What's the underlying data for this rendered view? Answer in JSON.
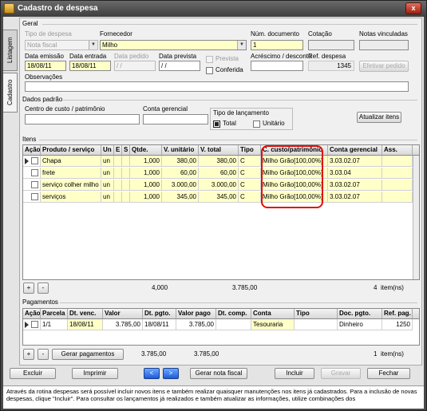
{
  "window": {
    "title": "Cadastro de despesa",
    "close": "x"
  },
  "tabs": [
    "Listagem",
    "Cadastro"
  ],
  "geral": {
    "section": "Geral",
    "tipo_label": "Tipo de despesa",
    "tipo_value": "Nota fiscal",
    "fornecedor_label": "Fornecedor",
    "fornecedor_value": "Milho",
    "num_doc_label": "Núm. documento",
    "num_doc_value": "1",
    "cotacao_label": "Cotação",
    "cotacao_value": "",
    "notas_label": "Notas vinculadas",
    "notas_value": "",
    "emissao_label": "Data emissão",
    "emissao_value": "18/08/11",
    "entrada_label": "Data entrada",
    "entrada_value": "18/08/11",
    "pedido_label": "Data pedido",
    "pedido_value": " / /",
    "prevista_label": "Data prevista",
    "prevista_value": " / /",
    "prevista_chk": "Prevista",
    "conferida_chk": "Conferida",
    "acrescimo_label": "Acréscimo / desconto",
    "acrescimo_value": "",
    "ref_label": "Ref. despesa",
    "ref_value": "1345",
    "efetivar_btn": "Efetivar pedido",
    "obs_label": "Observações",
    "obs_value": ""
  },
  "padrao": {
    "section": "Dados padrão",
    "centro_label": "Centro de custo / patrimônio",
    "centro_value": "",
    "conta_label": "Conta gerencial",
    "conta_value": "",
    "tipo_lanc_label": "Tipo de lançamento",
    "total_opt": "Total",
    "unitario_opt": "Unitário",
    "atualizar_btn": "Atualizar itens"
  },
  "itens": {
    "section": "Itens",
    "headers": [
      "Ação",
      "Produto / serviço",
      "Un",
      "E",
      "S",
      "Qtde.",
      "V. unitário",
      "V. total",
      "Tipo",
      "C. custo/patrimônio",
      "Conta gerencial",
      "Ass."
    ],
    "rows": [
      [
        "Chapa",
        "un",
        "1,000",
        "380,00",
        "380,00",
        "C",
        "Milho  Grão[100,00%]",
        "3.03.02.07"
      ],
      [
        "frete",
        "un",
        "1,000",
        "60,00",
        "60,00",
        "C",
        "Milho  Grão[100,00%]",
        "3.03.04"
      ],
      [
        "serviço colher milho",
        "un",
        "1,000",
        "3.000,00",
        "3.000,00",
        "C",
        "Milho  Grão[100,00%]",
        "3.03.02.07"
      ],
      [
        "serviços",
        "un",
        "1,000",
        "345,00",
        "345,00",
        "C",
        "Milho  Grão[100,00%]",
        "3.03.02.07"
      ]
    ],
    "add_btn": "+",
    "remove_btn": "-",
    "total_qtde": "4,000",
    "total_valor": "3.785,00",
    "count": "4",
    "count_label": "item(ns)"
  },
  "pagamentos": {
    "section": "Pagamentos",
    "headers": [
      "Ação",
      "Parcela",
      "Dt. venc.",
      "Valor",
      "Dt. pgto.",
      "Valor pago",
      "Dt. comp.",
      "Conta",
      "Tipo",
      "Doc. pgto.",
      "Ref. pag."
    ],
    "rows": [
      [
        "1/1",
        "18/08/11",
        "3.785,00",
        "18/08/11",
        "3.785,00",
        "",
        "Tesouraria",
        "",
        "Dinheiro",
        "1250"
      ]
    ],
    "add_btn": "+",
    "remove_btn": "-",
    "gerar_btn": "Gerar pagamentos",
    "total_valor": "3.785,00",
    "total_pago": "3.785,00",
    "count": "1",
    "count_label": "item(ns)"
  },
  "actions": {
    "excluir": "Excluir",
    "imprimir": "Imprimir",
    "prev": "<",
    "next": ">",
    "gerar_nota": "Gerar nota fiscal",
    "incluir": "Incluir",
    "gravar": "Gravar",
    "fechar": "Fechar"
  },
  "status_text": "Através da rotina despesas será possível incluir novos itens e também realizar quaisquer manutenções nos itens já cadastrados. Para a inclusão de novas despesas, clique \"Incluir\". Para consultar os lançamentos já realizados e também atualizar as informações, utilize combinações dos"
}
